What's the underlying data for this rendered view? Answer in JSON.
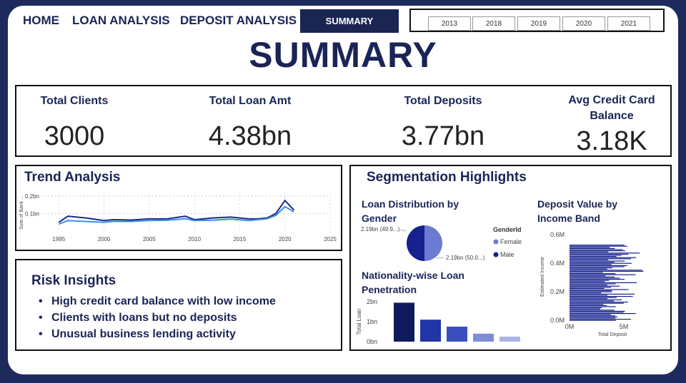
{
  "nav": {
    "home": "HOME",
    "loan": "LOAN ANALYSIS",
    "deposit": "DEPOSIT ANALYSIS",
    "summary": "SUMMARY"
  },
  "years": [
    "2013",
    "2018",
    "2019",
    "2020",
    "2021"
  ],
  "page_title": "SUMMARY",
  "kpis": [
    {
      "label": "Total Clients",
      "value": "3000"
    },
    {
      "label": "Total Loan Amt",
      "value": "4.38bn"
    },
    {
      "label": "Total Deposits",
      "value": "3.77bn"
    },
    {
      "label": "Avg Credit Card Balance",
      "value": "3.18K"
    }
  ],
  "trend": {
    "title": "Trend Analysis",
    "ylabel": "Sum of Bank ...",
    "yticks": [
      "0.2bn",
      "0.1bn"
    ],
    "xticks": [
      "1995",
      "2000",
      "2005",
      "2010",
      "2015",
      "2020",
      "2025"
    ]
  },
  "risk": {
    "title": "Risk Insights",
    "items": [
      "High credit card balance with low income",
      "Clients with loans but no deposits",
      "Unusual business lending activity"
    ]
  },
  "segmentation": {
    "title": "Segmentation Highlights",
    "gender": {
      "title_1": "Loan Distribution by",
      "title_2": "Gender",
      "left_label": "2.19bn (49.9...)",
      "right_label": "2.19bn (50.0...)",
      "legend_title": "GenderId",
      "legend": [
        "Female",
        "Male"
      ]
    },
    "nationality": {
      "title_1": "Nationality-wise Loan",
      "title_2": "Penetration",
      "ylabel": "Total Loan",
      "yticks": [
        "2bn",
        "1bn",
        "0bn"
      ]
    },
    "income": {
      "title_1": "Deposit Value by",
      "title_2": "Income Band",
      "ylabel": "Estimated Income",
      "xlabel": "Total Deposit",
      "yticks": [
        "0.6M",
        "0.4M",
        "0.2M",
        "0.0M"
      ],
      "xticks": [
        "0M",
        "5M"
      ]
    }
  },
  "colors": {
    "navy": "#1a2456",
    "female": "#6c7bd1",
    "male": "#14218e",
    "line1": "#1a2a8c",
    "line2": "#3a8ee6"
  },
  "chart_data": [
    {
      "type": "line",
      "title": "Trend Analysis",
      "xlabel": "",
      "ylabel": "Sum of Bank ...",
      "xlim": [
        1993,
        2025
      ],
      "ylim": [
        0,
        0.22
      ],
      "series": [
        {
          "x": [
            1995,
            1996,
            1998,
            2000,
            2001,
            2003,
            2005,
            2007,
            2009,
            2010,
            2012,
            2014,
            2016,
            2017,
            2018,
            2019,
            2020,
            2021
          ],
          "values": [
            0.05,
            0.085,
            0.075,
            0.06,
            0.065,
            0.063,
            0.07,
            0.07,
            0.085,
            0.065,
            0.075,
            0.08,
            0.07,
            0.07,
            0.075,
            0.1,
            0.175,
            0.12
          ]
        },
        {
          "x": [
            1995,
            1996,
            1998,
            2000,
            2001,
            2003,
            2005,
            2007,
            2009,
            2010,
            2012,
            2014,
            2016,
            2017,
            2018,
            2019,
            2020,
            2021
          ],
          "values": [
            0.04,
            0.06,
            0.055,
            0.05,
            0.055,
            0.055,
            0.06,
            0.062,
            0.07,
            0.06,
            0.062,
            0.068,
            0.06,
            0.065,
            0.07,
            0.09,
            0.14,
            0.11
          ]
        }
      ]
    },
    {
      "type": "pie",
      "title": "Loan Distribution by Gender",
      "categories": [
        "Female",
        "Male"
      ],
      "values": [
        50.0,
        49.9
      ]
    },
    {
      "type": "bar",
      "title": "Nationality-wise Loan Penetration",
      "ylabel": "Total Loan",
      "ylim": [
        0,
        2
      ],
      "values": [
        1.95,
        1.1,
        0.75,
        0.4,
        0.25
      ]
    },
    {
      "type": "bar",
      "title": "Deposit Value by Income Band",
      "xlabel": "Total Deposit",
      "ylabel": "Estimated Income",
      "xlim": [
        0,
        9
      ],
      "ylim": [
        0,
        0.6
      ],
      "orientation": "horizontal"
    }
  ]
}
